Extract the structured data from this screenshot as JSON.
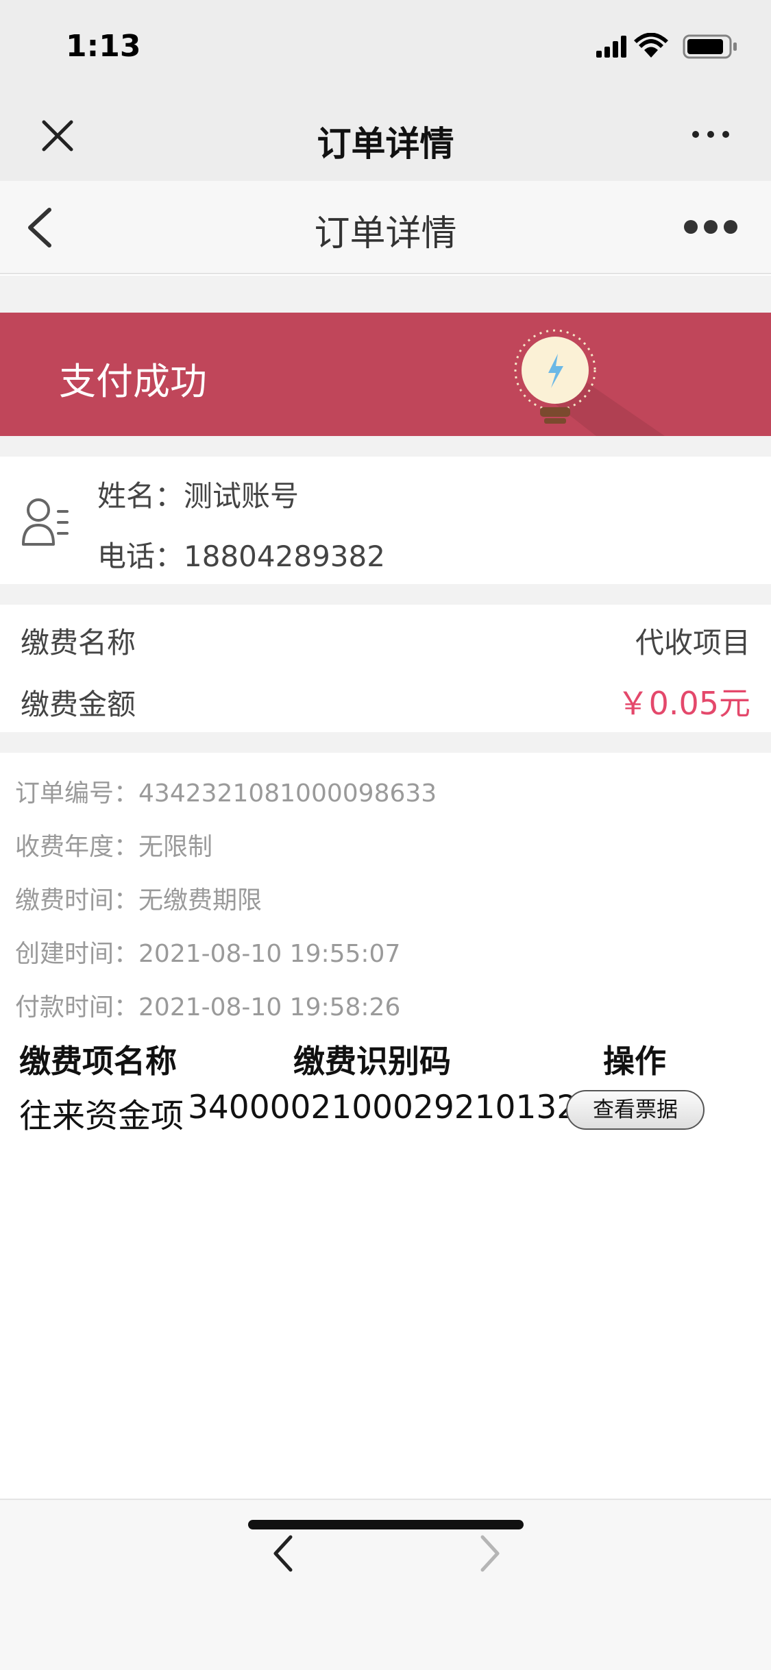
{
  "status_bar": {
    "time": "1:13",
    "icons": [
      "signal-icon",
      "wifi-icon",
      "battery-icon"
    ]
  },
  "wechat_bar": {
    "title": "订单详情",
    "icons": [
      "close-icon",
      "more-icon"
    ]
  },
  "nav_bar": {
    "title": "订单详情",
    "icons": [
      "back-icon",
      "more-icon"
    ]
  },
  "banner": {
    "text": "支付成功",
    "icon": "lightbulb-icon",
    "color": "#c0465a"
  },
  "user": {
    "name_label": "姓名：",
    "name_value": "测试账号",
    "phone_label": "电话：",
    "phone_value": "18804289382",
    "icon": "user-list-icon"
  },
  "fee": {
    "name_label": "缴费名称",
    "name_value": "代收项目",
    "amount_label": "缴费金额",
    "amount_value": "￥0.05元",
    "amount_color": "#e4486b"
  },
  "order_info": [
    {
      "label": "订单编号：",
      "value": "4342321081000098633"
    },
    {
      "label": "收费年度：",
      "value": "无限制"
    },
    {
      "label": "缴费时间：",
      "value": "无缴费期限"
    },
    {
      "label": "创建时间：",
      "value": "2021-08-10 19:55:07"
    },
    {
      "label": "付款时间：",
      "value": "2021-08-10 19:58:26"
    }
  ],
  "items_table": {
    "headers": [
      "缴费项名称",
      "缴费识别码",
      "操作"
    ],
    "rows": [
      {
        "name": "往来资金项",
        "code": "340000210002921013​27",
        "action": "查看票据"
      }
    ]
  },
  "bottom_bar": {
    "icons": [
      "back-icon",
      "forward-icon"
    ]
  }
}
